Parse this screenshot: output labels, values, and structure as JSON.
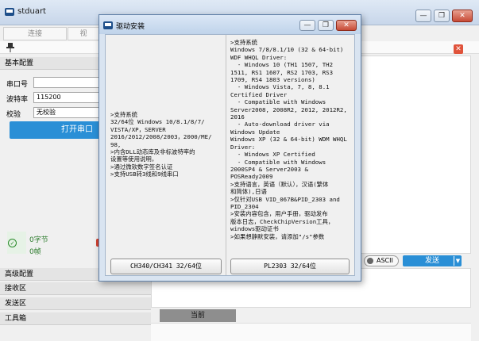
{
  "window": {
    "title": "stduart",
    "min": "—",
    "max": "❐",
    "close": "✕"
  },
  "tabs": [
    "连接",
    "视"
  ],
  "toolbar": {
    "pin_icon": "📌",
    "close_icon": "✕",
    "refresh_icon": "⟳",
    "clear_icon": "⌫"
  },
  "sidebar": {
    "basic_config": "基本配置",
    "port_label": "串口号",
    "port_value": "",
    "baud_label": "波特率",
    "baud_value": "115200",
    "parity_label": "校验",
    "parity_value": "无校验",
    "open_button": "打开串口",
    "byte_count": "0字节",
    "frame_count": "0帧",
    "sections": [
      "高级配置",
      "接收区",
      "发送区",
      "工具箱"
    ]
  },
  "send_bar": {
    "ascii": "ASCII",
    "send": "发送"
  },
  "bottom": {
    "current_tab": "当前"
  },
  "dialog": {
    "title": "驱动安装",
    "left_text": ">支持系统\n32/64位 Windows 10/8.1/8/7/\nVISTA/XP，SERVER\n2016/2012/2008/2003，2000/ME/\n98,\n>内含DLL动态库及非标波特率的\n设置等使用说明，\n>通过微软数字签名认证\n>支持USB转3线和9线串口",
    "right_text": ">支持系统\nWindows 7/8/8.1/10 (32 & 64-bit)\nWDF WHQL Driver:\n  - Windows 10 (TH1 1507, TH2\n1511, RS1 1607, RS2 1703, RS3\n1709, RS4 1803 versions)\n  - Windows Vista, 7, 8, 8.1\nCertified Driver\n  - Compatible with Windows\nServer2008, 2008R2, 2012, 2012R2,\n2016\n  - Auto-download driver via\nWindows Update\nWindows XP (32 & 64-bit) WDM WHQL\nDriver:\n  - Windows XP Certified\n  - Compatible with Windows\n2000SP4 & Server2003 &\nPOSReady2009\n>支持语言，英语（默认），汉语(繁体\n和简体),日语\n>仅针对USB VID_067B&PID_2303 and\nPID_2304\n>安装内容包含，用户手册，驱动发布\n版本日志，CheckChipVersion工具，\nwindows驱动证书\n>如果想静默安装，请添加\"/s\"参数",
    "left_button": "CH340/CH341 32/64位",
    "right_button": "PL2303 32/64位",
    "min": "—",
    "max": "❐",
    "close": "✕"
  }
}
